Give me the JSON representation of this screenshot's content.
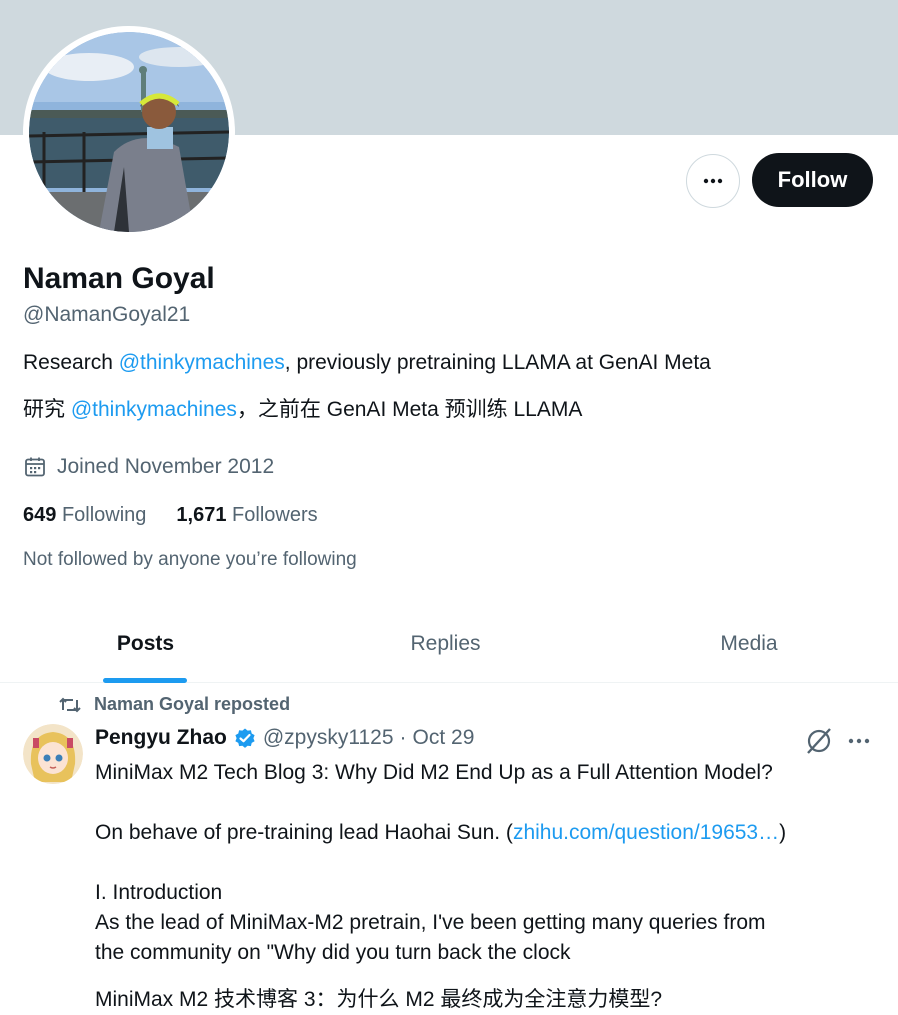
{
  "profile": {
    "name": "Naman Goyal",
    "handle": "@NamanGoyal21",
    "bio_line1": {
      "prefix": "Research ",
      "mention": "@thinkymachines",
      "suffix": ", previously pretraining LLAMA at GenAI Meta"
    },
    "bio_line2": {
      "prefix": "研究 ",
      "mention": "@thinkymachines",
      "suffix": "，之前在 GenAI Meta 预训练 LLAMA"
    },
    "joined": "Joined November 2012",
    "following_count": "649",
    "following_label": "Following",
    "followers_count": "1,671",
    "followers_label": "Followers",
    "not_followed_note": "Not followed by anyone you’re following",
    "follow_label": "Follow",
    "more_icon": "more-horizontal-icon"
  },
  "tabs": [
    {
      "label": "Posts",
      "active": true
    },
    {
      "label": "Replies",
      "active": false
    },
    {
      "label": "Media",
      "active": false
    }
  ],
  "post": {
    "repost_label": "Naman Goyal reposted",
    "author": "Pengyu Zhao",
    "verified": true,
    "handle": "@zpysky1125",
    "separator": "·",
    "date": "Oct 29",
    "line1": "MiniMax M2 Tech Blog 3: Why Did M2 End Up as a Full Attention Model?",
    "line2_prefix": "On behave of pre-training lead Haohai Sun. (",
    "line2_link": "zhihu.com/question/19653…",
    "line2_suffix": ")",
    "line3": "I. Introduction",
    "line4": "As the lead of MiniMax-M2 pretrain, I've been getting many queries from",
    "line5": "the community on \"Why did you turn back the clock",
    "line6": "MiniMax M2 技术博客 3：为什么 M2 最终成为全注意力模型?"
  },
  "colors": {
    "banner": "#cfd9de",
    "accent": "#1d9bf0",
    "text_primary": "#0f1419",
    "text_secondary": "#536471"
  }
}
